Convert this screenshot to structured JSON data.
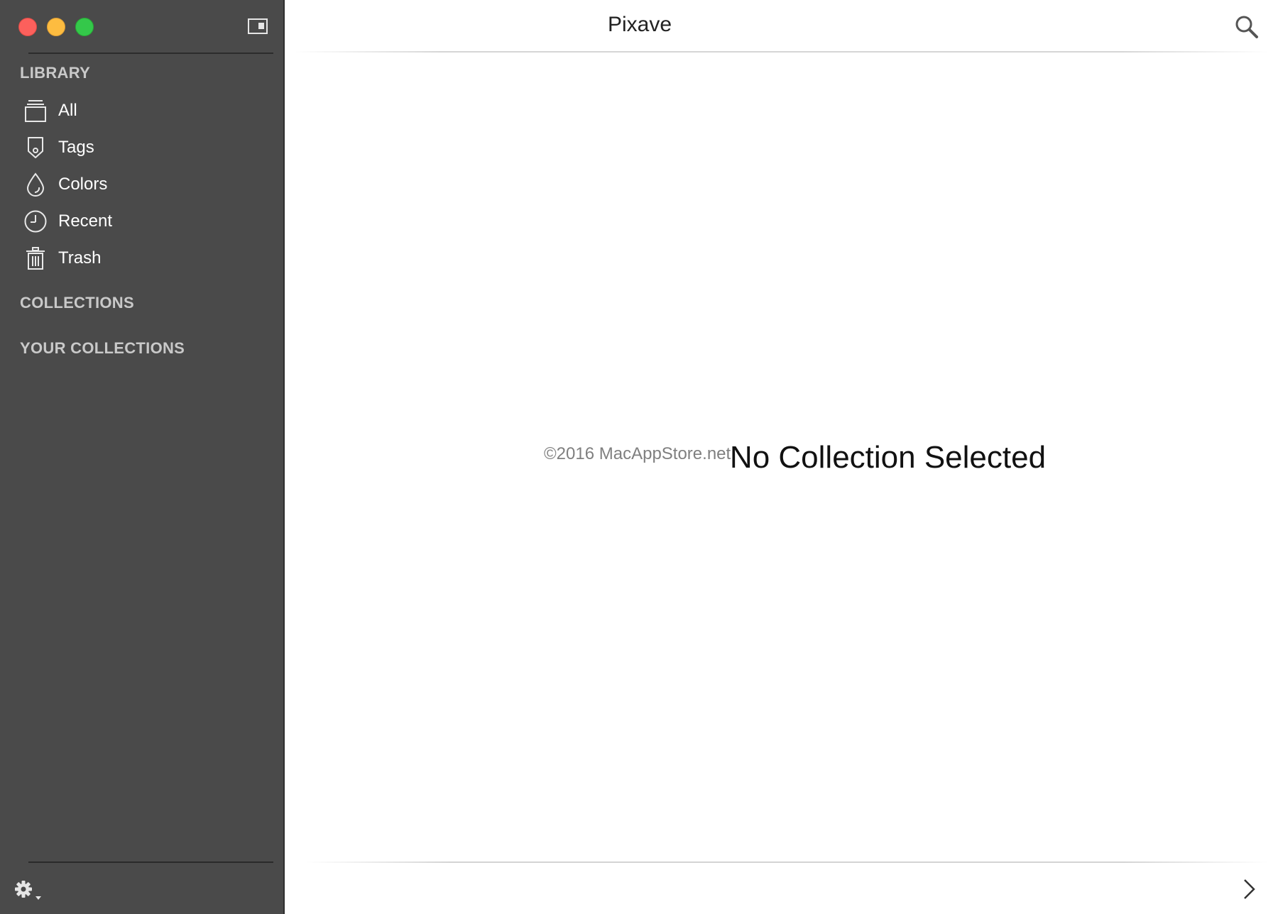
{
  "app": {
    "title": "Pixave"
  },
  "sidebar": {
    "library_header": "LIBRARY",
    "library_items": [
      {
        "label": "All",
        "icon": "tray-icon"
      },
      {
        "label": "Tags",
        "icon": "tag-icon"
      },
      {
        "label": "Colors",
        "icon": "droplet-icon"
      },
      {
        "label": "Recent",
        "icon": "clock-icon"
      },
      {
        "label": "Trash",
        "icon": "trash-icon"
      }
    ],
    "collections_header": "COLLECTIONS",
    "your_collections_header": "YOUR COLLECTIONS"
  },
  "main": {
    "empty_message": "No Collection Selected",
    "watermark": "©2016 MacAppStore.net"
  },
  "colors": {
    "sidebar_bg": "#4a4a4a",
    "header_text": "#c9c9c9",
    "close": "#fc605c",
    "minimize": "#fdbc40",
    "maximize": "#34c84a"
  }
}
